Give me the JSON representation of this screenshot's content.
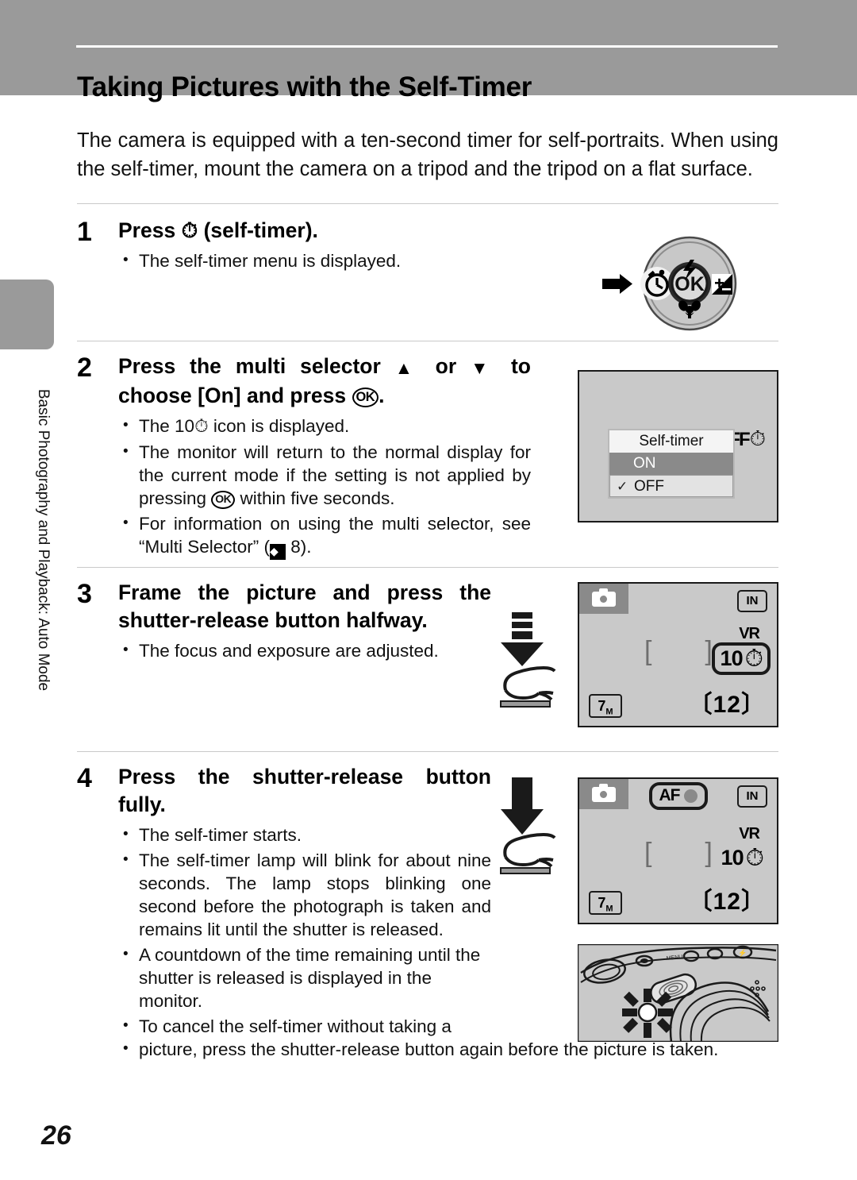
{
  "header": {
    "title": "Taking Pictures with the Self-Timer"
  },
  "side_tab": {
    "label": "Basic Photography and Playback: Auto Mode"
  },
  "intro": "The camera is equipped with a ten-second timer for self-portraits. When using the self-timer, mount the camera on a tripod and the tripod on a flat surface.",
  "steps": [
    {
      "number": "1",
      "heading_pre": "Press ",
      "heading_icon": "self-timer-icon",
      "heading_post": " (self-timer).",
      "bullets": [
        "The self-timer menu is displayed."
      ]
    },
    {
      "number": "2",
      "heading_line1_a": "Press the multi selector ",
      "heading_up": "▲",
      "heading_line1_b": " or ",
      "heading_down": "▼",
      "heading_line1_c": " to",
      "heading_line2_a": "choose [On] and press ",
      "heading_ok": "OK",
      "heading_line2_b": ".",
      "bullets": [
        {
          "pre": "The 10",
          "icon": "self-timer-icon",
          "post": " icon is displayed."
        },
        {
          "pre": "The monitor will return to the normal display for the current mode if the setting is not applied by pressing ",
          "icon": "ok-icon",
          "post": " within five seconds."
        },
        {
          "pre": "For information on using the multi selector, see “Multi Selector” (",
          "icon": "ref-icon",
          "post": " 8)."
        }
      ]
    },
    {
      "number": "3",
      "heading": "Frame the picture and press the shutter-release button halfway.",
      "bullets": [
        "The focus and exposure are adjusted."
      ]
    },
    {
      "number": "4",
      "heading": "Press the shutter-release button fully.",
      "bullets": [
        "The self-timer starts.",
        "The self-timer lamp will blink for about nine seconds. The lamp stops blinking one second before the photograph is taken and remains lit until the shutter is released.",
        "A countdown of the time remaining until the shutter is released is displayed in the monitor.",
        "To cancel the self-timer without taking a"
      ],
      "bullet_last_continuation": "picture, press the shutter-release button again before the picture is taken."
    }
  ],
  "figures": {
    "multi_selector": {
      "center_label": "OK",
      "top_icon": "flash-icon",
      "left_icon": "self-timer-icon",
      "right_icon": "exposure-compensation-icon",
      "bottom_icon": "macro-icon",
      "pointer_icon": "arrow-right-icon"
    },
    "self_timer_menu": {
      "title": "Self-timer",
      "options": [
        {
          "label": "ON",
          "selected": true,
          "checked": false
        },
        {
          "label": "OFF",
          "selected": false,
          "checked": true
        }
      ],
      "check_mark": "✓",
      "status_text": "OFF",
      "status_icon": "self-timer-icon"
    },
    "monitor_step3": {
      "mode_icon": "camera-mode-icon",
      "memory_label": "IN",
      "vr_label": "VR",
      "timer_value": "10",
      "timer_icon": "self-timer-icon",
      "timer_highlighted": true,
      "focus_brackets": "[   ]",
      "resolution": "7",
      "resolution_unit": "M",
      "frames_remaining": "12",
      "frames_left_bracket": "〔",
      "frames_right_bracket": "〕"
    },
    "monitor_step4": {
      "mode_icon": "camera-mode-icon",
      "af_label": "AF",
      "af_highlighted": true,
      "memory_label": "IN",
      "vr_label": "VR",
      "timer_value": "10",
      "timer_icon": "self-timer-icon",
      "timer_highlighted": false,
      "focus_brackets": "[   ]",
      "resolution": "7",
      "resolution_unit": "M",
      "frames_remaining": "12",
      "frames_left_bracket": "〔",
      "frames_right_bracket": "〕"
    },
    "press_halfway": {
      "icon": "arrow-down-dashed-icon",
      "hand_icon": "finger-press-icon"
    },
    "press_fully": {
      "icon": "arrow-down-solid-icon",
      "hand_icon": "finger-press-icon"
    },
    "camera_lamp": {
      "icon": "camera-front-self-timer-lamp-icon"
    }
  },
  "page_number": "26",
  "colors": {
    "header_band": "#9a9a9a",
    "screen_background": "#c9c9c9",
    "screen_border": "#1a1a1a",
    "menu_selected": "#8a8a8a",
    "rule": "#c9c9c9"
  }
}
